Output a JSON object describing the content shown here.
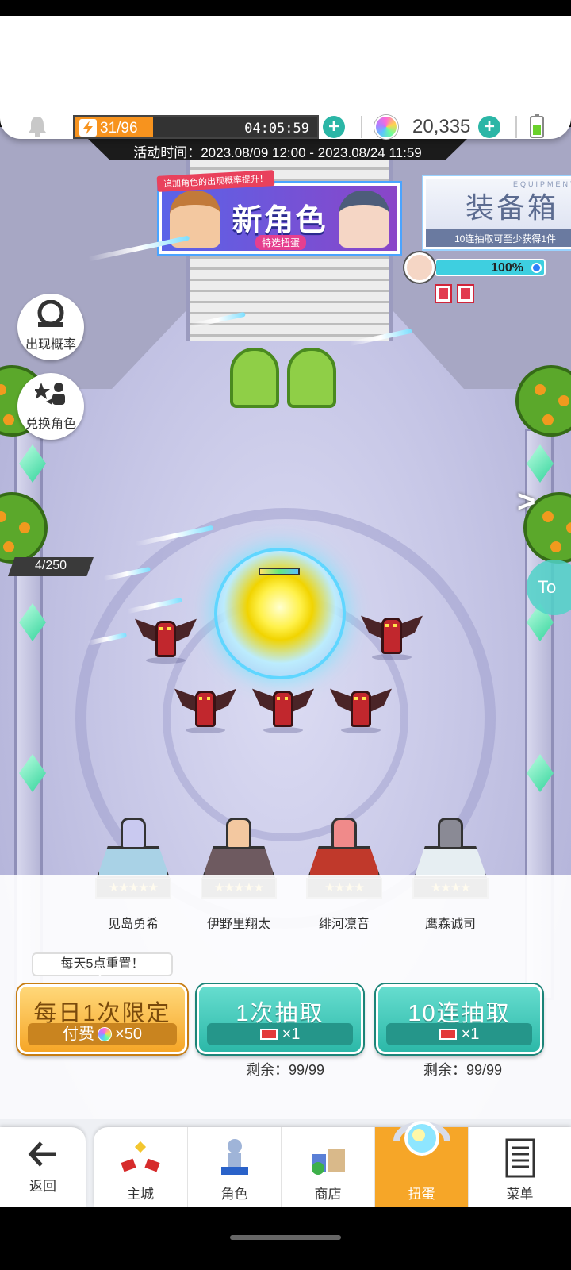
{
  "resources": {
    "energy": "31/96",
    "energy_fill_fraction": 0.323,
    "energy_timer": "04:05:59",
    "gems": "20,335",
    "battery_fill_fraction": 0.55
  },
  "event": {
    "time_text": "活动时间：2023.08/09 12:00 - 2023.08/24 11:59"
  },
  "banners": {
    "new_char": {
      "ribbon": "追加角色的出现概率提升！",
      "title": "新角色",
      "subtitle": "特选扭蛋"
    },
    "equipment": {
      "small": "EQUIPMENT",
      "title": "装备箱",
      "subtitle": "10连抽取可至少获得1件"
    },
    "progress_percent": "100%"
  },
  "side_buttons": {
    "rates": "出现概率",
    "exchange": "兑换角色",
    "exchange_count": "4/250",
    "next_arrow": ">",
    "right_tag": "To"
  },
  "characters": [
    {
      "name": "见岛勇希",
      "stars": "★★★★★",
      "top_color": "#a9d2e6",
      "char_color": "#c9c9f0"
    },
    {
      "name": "伊野里翔太",
      "stars": "★★★★★",
      "top_color": "#6e5a60",
      "char_color": "#f3c8a0"
    },
    {
      "name": "绯河凛音",
      "stars": "★★★★",
      "top_color": "#c0392b",
      "char_color": "#f08a8a"
    },
    {
      "name": "鹰森诚司",
      "stars": "★★★★",
      "top_color": "#e6eef2",
      "char_color": "#8a8a95"
    }
  ],
  "draw": {
    "reset_tip": "每天5点重置！",
    "daily": {
      "label": "每日1次限定",
      "cost_prefix": "付费",
      "cost": "×50"
    },
    "single": {
      "label": "1次抽取",
      "cost": "×1",
      "remain": "剩余：99/99"
    },
    "ten": {
      "label": "10连抽取",
      "cost": "×1",
      "remain": "剩余：99/99"
    }
  },
  "nav": {
    "back": "返回",
    "items": [
      "主城",
      "角色",
      "商店",
      "扭蛋",
      "菜单"
    ],
    "active_index": 3
  },
  "colors": {
    "accent_teal": "#2cb8a8",
    "accent_orange": "#f6a628",
    "energy_orange": "#f7931e"
  },
  "icons": {
    "bell": "bell-icon",
    "bolt": "lightning-icon",
    "gem": "rainbow-gem-icon",
    "ticket": "ticket-icon"
  }
}
